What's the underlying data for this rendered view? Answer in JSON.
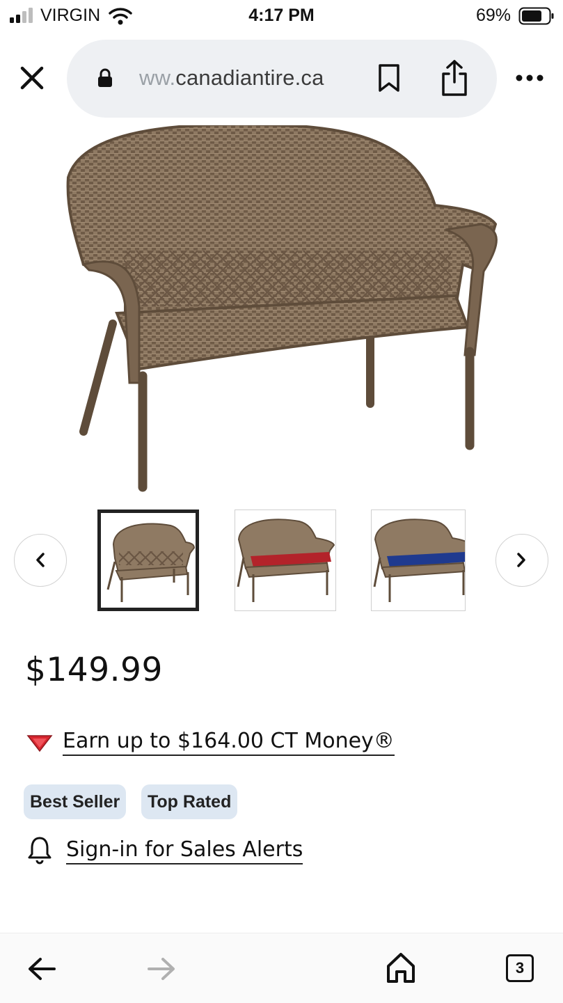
{
  "status_bar": {
    "carrier": "VIRGIN",
    "time": "4:17 PM",
    "battery": "69%"
  },
  "browser": {
    "url_faded": "ww.",
    "url_main": "canadiantire.ca"
  },
  "product": {
    "price": "$149.99",
    "ct_money": "Earn up to $164.00 CT Money®",
    "badges": [
      "Best Seller",
      "Top Rated"
    ],
    "sales_alerts": "Sign-in for Sales Alerts",
    "thumbnails": [
      {
        "cushion": "none",
        "selected": true
      },
      {
        "cushion": "#b3232a",
        "selected": false
      },
      {
        "cushion": "#1f3a8f",
        "selected": false
      }
    ]
  },
  "tabs": {
    "count": "3"
  },
  "colors": {
    "wicker": "#8a7560",
    "wicker_dark": "#5e4c3a",
    "badge_bg": "#dde7f2",
    "ct_red": "#d8262f"
  }
}
